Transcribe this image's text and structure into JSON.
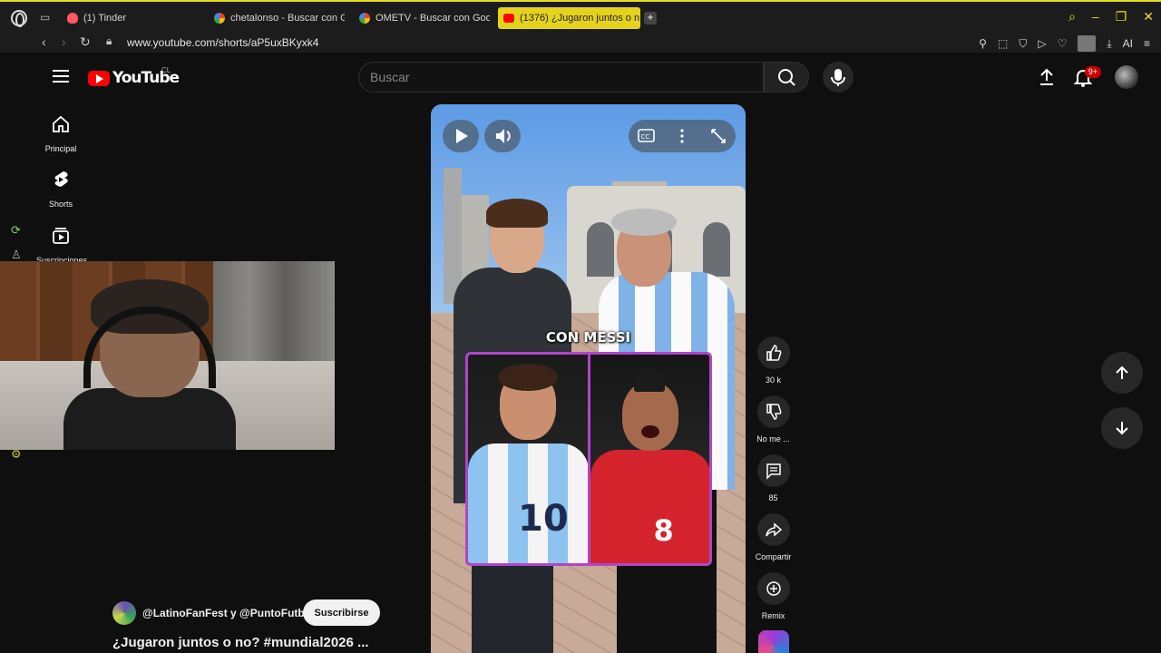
{
  "browser": {
    "tabs": [
      {
        "label": "(1) Tinder",
        "favicon": "tinder-favicon"
      },
      {
        "label": "chetalonso - Buscar con G",
        "favicon": "google-favicon"
      },
      {
        "label": "OMETV - Buscar con Goo",
        "favicon": "google-favicon"
      },
      {
        "label": "(1376) ¿Jugaron juntos o n",
        "favicon": "youtube-favicon",
        "active": true
      }
    ],
    "new_tab_label": "+",
    "url": "www.youtube.com/shorts/aP5uxBKyxk4",
    "ai_label": "AI",
    "accent_color": "#e5d21c"
  },
  "youtube": {
    "logo_text": "YouTube",
    "country_code": "CL",
    "search_placeholder": "Buscar",
    "notification_count": "9+",
    "nav": [
      {
        "label": "Principal",
        "icon": "home-icon"
      },
      {
        "label": "Shorts",
        "icon": "shorts-icon"
      },
      {
        "label": "Suscripciones",
        "icon": "subscriptions-icon"
      }
    ],
    "brand_color": "#ff0000"
  },
  "short": {
    "caption": "CON MESSI",
    "jersey_numbers": [
      "10",
      "8"
    ],
    "actions": [
      {
        "label": "30 k",
        "icon": "like-icon"
      },
      {
        "label": "No me ...",
        "icon": "dislike-icon"
      },
      {
        "label": "85",
        "icon": "comment-icon"
      },
      {
        "label": "Compartir",
        "icon": "share-icon"
      },
      {
        "label": "Remix",
        "icon": "remix-icon"
      }
    ],
    "channel": "@LatinoFanFest y @PuntoFutbol",
    "subscribe_label": "Suscribirse",
    "title": "¿Jugaron juntos o no? #mundial2026 ..."
  }
}
